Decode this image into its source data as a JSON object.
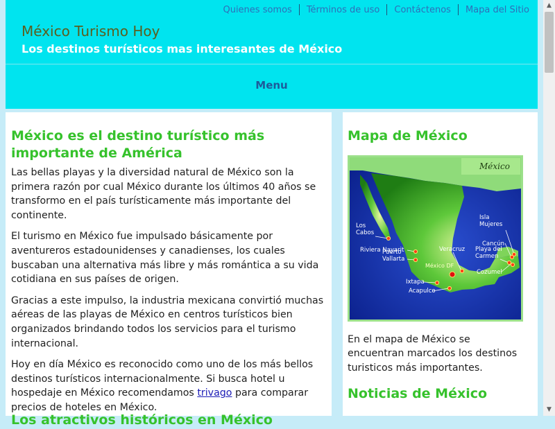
{
  "topnav": {
    "items": [
      "Quienes somos",
      "Términos de uso",
      "Contáctenos",
      "Mapa del Sitio"
    ]
  },
  "header": {
    "title": "México Turismo Hoy",
    "subtitle": "Los destinos turísticos mas interesantes de México",
    "menu_label": "Menu"
  },
  "main": {
    "heading": "México es el destino turístico más importante de América",
    "p1": "Las bellas playas y la diversidad natural de México son la primera razón por cual México durante los últimos 40 años se transformo en el país turísticamente más importante del continente.",
    "p2": "El turismo en México fue impulsado básicamente por aventureros estadounidenses y canadienses, los cuales buscaban una alternativa más libre y más romántica a su vida cotidiana en sus países de origen.",
    "p3": "Gracias a este impulso, la industria mexicana convirtió muchas aéreas de las playas de México en centros turísticos bien organizados brindando todos los servicios para el turismo internacional.",
    "p4_before": "Hoy en día México es reconocido como uno de los más bellos destinos turísticos internacionalmente. Si busca hotel u hospedaje en México recomendamos ",
    "p4_link": "trivago",
    "p4_after": " para comparar precios de hoteles en México.",
    "heading2": "Los atractivos históricos en México"
  },
  "sidebar": {
    "map_heading": "Mapa de México",
    "map": {
      "label": "México",
      "cities": [
        "Los Cabos",
        "Riviera Nayarit",
        "Puerto Vallarta",
        "Ixtapa",
        "Acapulco",
        "México DF",
        "Veracruz",
        "Isla Mujeres",
        "Cancún",
        "Playa del Carmen",
        "Cozumel"
      ]
    },
    "map_caption": "En el mapa de México se encuentran marcados los destinos turisticos más importantes.",
    "news_heading": "Noticias de México"
  },
  "colors": {
    "header_bg": "#00e4ef",
    "heading_green": "#36c22c",
    "page_bg": "#c6ecf8",
    "title_olive": "#5b5e1e"
  }
}
